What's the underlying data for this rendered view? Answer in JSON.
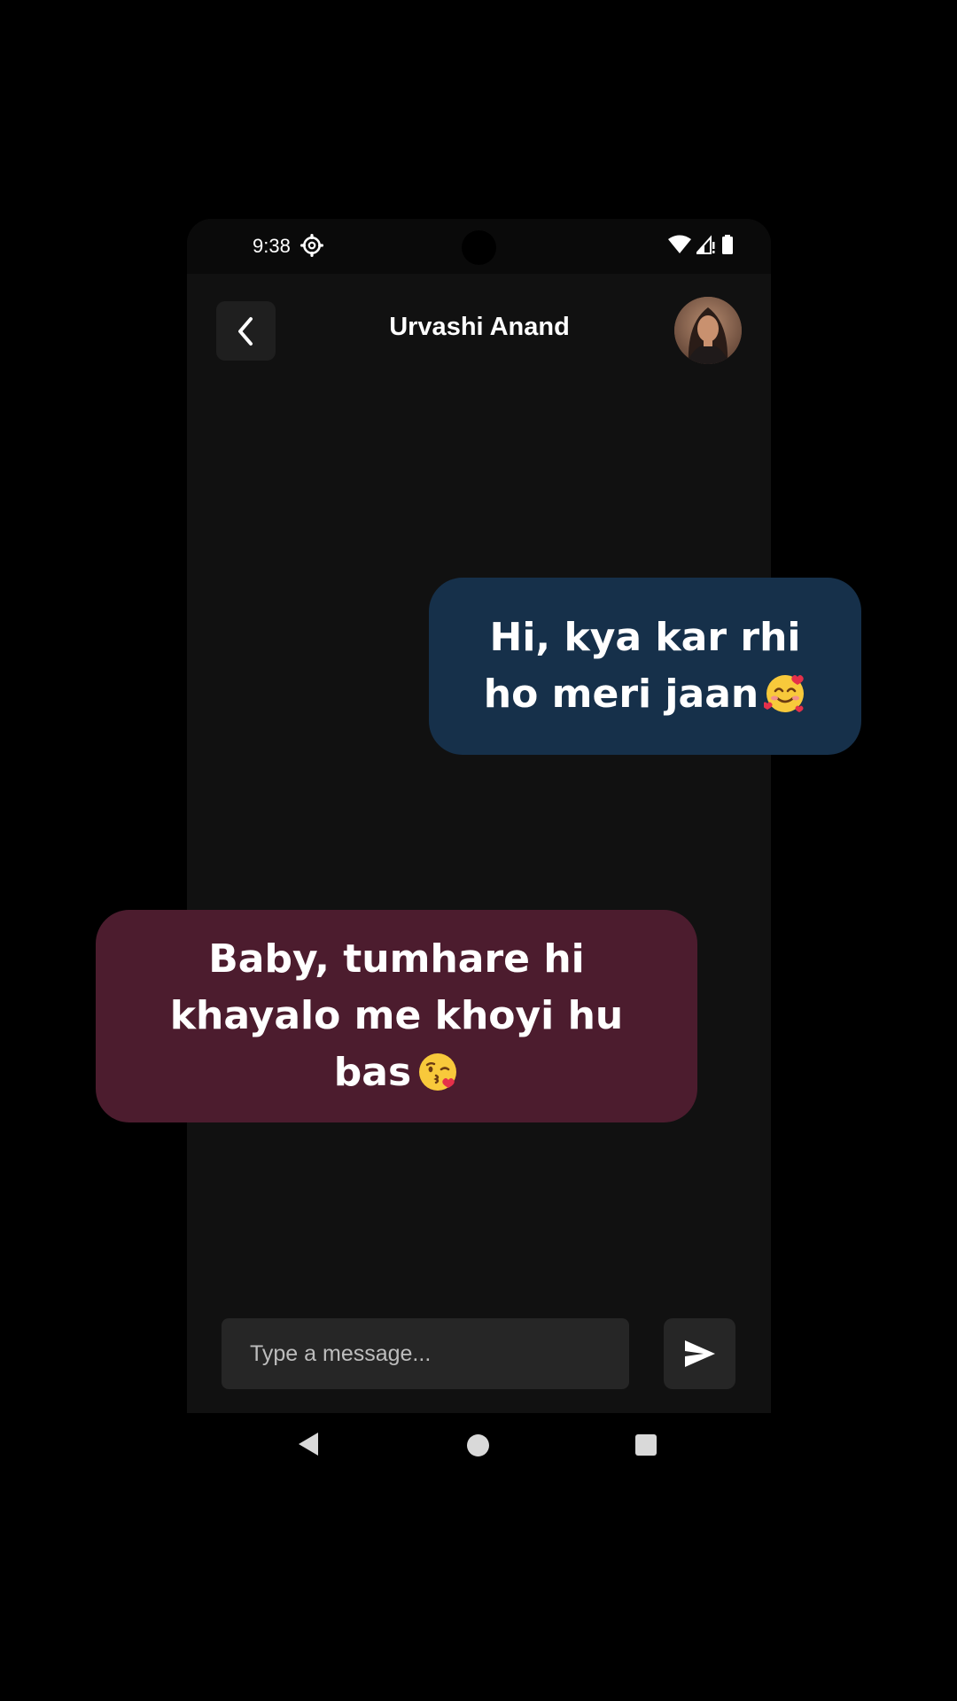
{
  "status_bar": {
    "time": "9:38"
  },
  "header": {
    "contact_name": "Urvashi Anand"
  },
  "messages": [
    {
      "direction": "sent",
      "text": "Hi, kya kar rhi ho meri jaan",
      "emoji": "smiling-face-with-hearts",
      "color": "#16304a"
    },
    {
      "direction": "received",
      "text": "Baby, tumhare hi khayalo me khoyi hu bas",
      "emoji": "face-blowing-kiss",
      "color": "#4c1c2e"
    }
  ],
  "composer": {
    "placeholder": "Type a message..."
  },
  "icons": {
    "back": "chevron-left-icon",
    "send": "send-icon",
    "settings": "gear-icon",
    "wifi": "wifi-icon",
    "signal": "signal-icon",
    "battery": "battery-icon"
  },
  "colors": {
    "background": "#000000",
    "phone_surface": "#111111",
    "control_surface": "#262626"
  }
}
